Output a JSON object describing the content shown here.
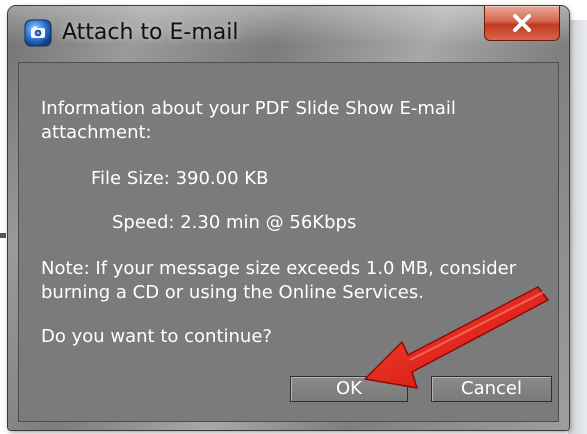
{
  "dialog": {
    "title": "Attach to E-mail",
    "close_symbol": "✕",
    "info_line1": "Information about your PDF Slide Show E-mail",
    "info_line2": "attachment:",
    "file_size_text": "File Size:  390.00 KB",
    "speed_text": "Speed:  2.30 min @ 56Kbps",
    "note_line1": "Note: If your message size exceeds 1.0 MB, consider",
    "note_line2": "burning a CD or using the Online Services.",
    "question": "Do you want to continue?",
    "ok_label": "OK",
    "cancel_label": "Cancel"
  },
  "icons": {
    "app": "camera-icon",
    "close": "close-icon",
    "annotation": "red-arrow-annotation"
  },
  "colors": {
    "client_background": "#7b7b7b",
    "text": "#ffffff",
    "close_button": "#c0391f",
    "arrow": "#e0140c"
  }
}
